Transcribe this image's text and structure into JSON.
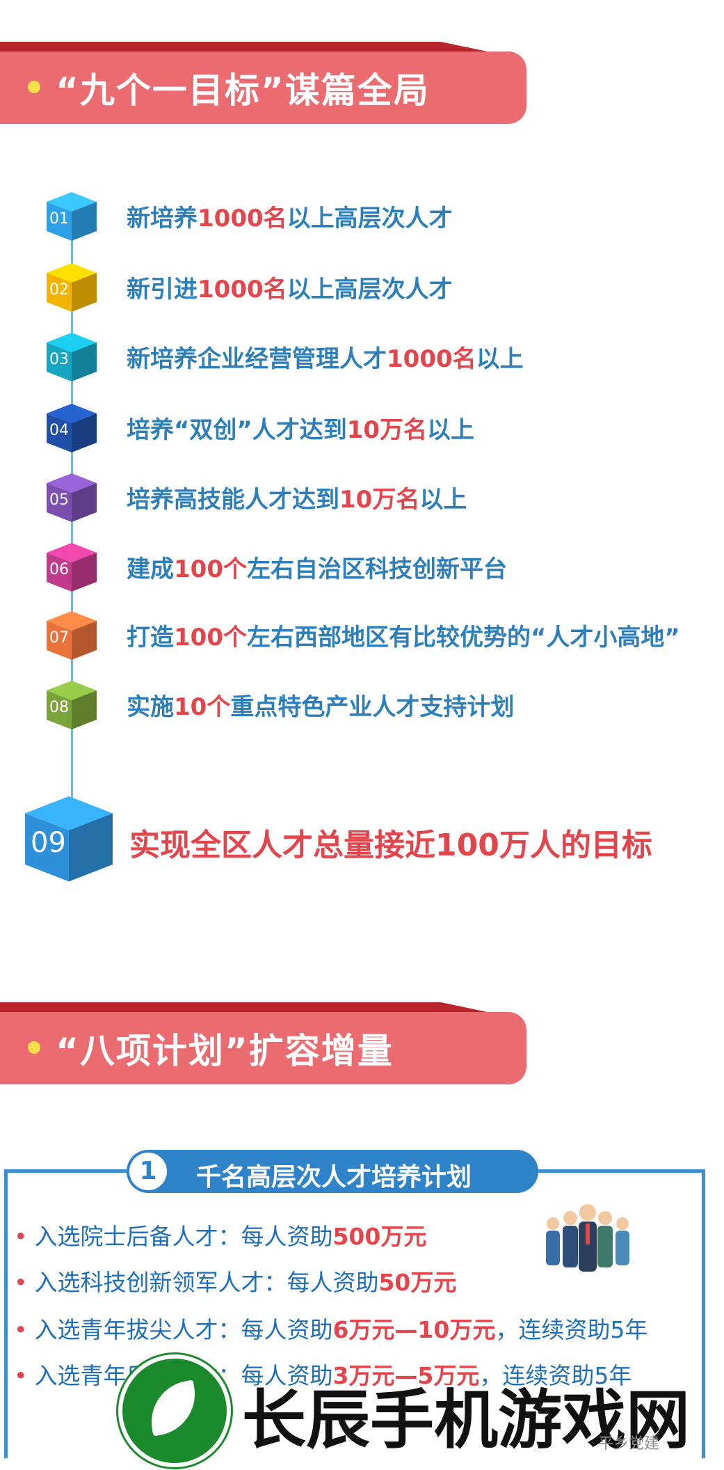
{
  "section1": {
    "title": "“九个一目标”谋篇全局",
    "items": [
      {
        "num": "01",
        "color": "#2ea0e6",
        "parts": [
          "新培养",
          "1000名",
          "以上高层次人才"
        ]
      },
      {
        "num": "02",
        "color": "#f2b400",
        "parts": [
          "新引进",
          "1000名",
          "以上高层次人才"
        ]
      },
      {
        "num": "03",
        "color": "#17a6c2",
        "parts": [
          "新培养企业经营管理人才",
          "1000名",
          "以上"
        ]
      },
      {
        "num": "04",
        "color": "#1f4fa6",
        "parts": [
          "培养“双创”人才达到",
          "10万名",
          "以上"
        ]
      },
      {
        "num": "05",
        "color": "#7a4fae",
        "parts": [
          "培养高技能人才达到",
          "10万名",
          "以上"
        ]
      },
      {
        "num": "06",
        "color": "#c23a8c",
        "parts": [
          "建成",
          "100个",
          "左右自治区科技创新平台"
        ]
      },
      {
        "num": "07",
        "color": "#e9713a",
        "parts": [
          "打造",
          "100个",
          "左右西部地区有比较优势的“人才小高地”"
        ]
      },
      {
        "num": "08",
        "color": "#7aa33a",
        "parts": [
          "实施",
          "10个",
          "重点特色产业人才支持计划"
        ]
      }
    ],
    "final": {
      "num": "09",
      "color": "#2e90d8",
      "text": "实现全区人才总量接近100万人的目标"
    }
  },
  "section2": {
    "title": "“八项计划”扩容增量",
    "plan": {
      "index": "1",
      "label": "千名高层次人才培养计划",
      "bullets": [
        [
          "入选院士后备人才：每人资助",
          "500万元",
          ""
        ],
        [
          "入选科技创新领军人才：每人资助",
          "50万元",
          ""
        ],
        [
          "入选青年拔尖人才：每人资助",
          "6万元—10万元",
          "，连续资助5年"
        ],
        [
          "入选青年后备人才：每人资助",
          "3万元—5万元",
          "，连续资助5年"
        ]
      ]
    }
  },
  "watermark": {
    "text": "长辰手机游戏网",
    "source": "平乡党建"
  }
}
